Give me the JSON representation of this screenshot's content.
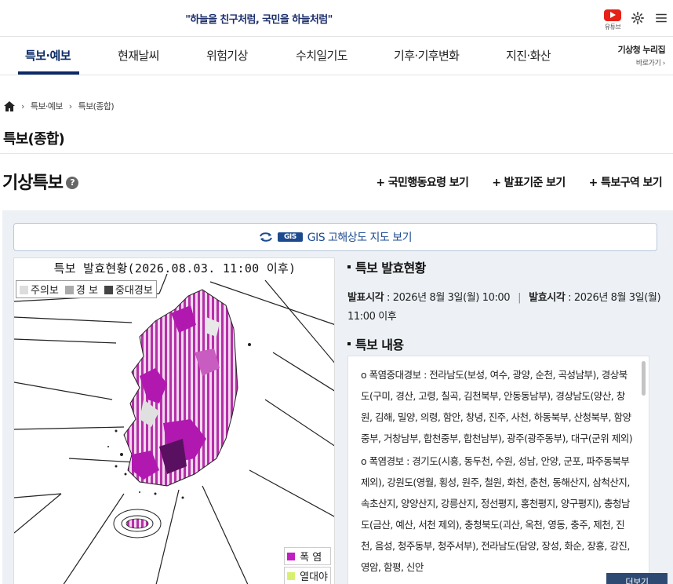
{
  "header": {
    "slogan": "\"하늘을 친구처럼, 국민을 하늘처럼\"",
    "youtube_label": "유튜브",
    "icons": [
      "youtube-icon",
      "gear-icon",
      "menu-icon"
    ]
  },
  "gnb": {
    "items": [
      "특보·예보",
      "현재날씨",
      "위험기상",
      "수치일기도",
      "기후·기후변화",
      "지진·화산"
    ],
    "active": "특보·예보",
    "right_title": "기상청 누리집",
    "right_link": "바로가기 ›"
  },
  "breadcrumb": {
    "home_icon": "home-icon",
    "items": [
      "특보·예보",
      "특보(종합)"
    ]
  },
  "page_title": "특보(종합)",
  "section": {
    "title": "기상특보",
    "help": "?",
    "links": [
      "+ 국민행동요령 보기",
      "+ 발표기준 보기",
      "+ 특보구역 보기"
    ]
  },
  "gis": {
    "badge": "GIS",
    "label": "GIS 고해상도 지도 보기"
  },
  "map": {
    "title": "특보 발효현황(2026.08.03. 11:00 이후)",
    "legend": [
      "주의보",
      "경 보",
      "중대경보"
    ],
    "hazards": [
      {
        "label": "폭 염",
        "color": "#c020c0"
      },
      {
        "label": "열대야",
        "color": "#d8f070"
      }
    ]
  },
  "info": {
    "status_heading": "특보 발효현황",
    "announce_label": "발표시각",
    "announce_value": " : 2026년 8월 3일(월) 10:00",
    "effective_label": "발효시각",
    "effective_value": " : 2026년 8월 3일(월) 11:00 이후",
    "content_heading": "특보 내용",
    "paragraphs": [
      "o 폭염중대경보 : 전라남도(보성, 여수, 광양, 순천, 곡성남부), 경상북도(구미, 경산, 고령, 칠곡, 김천북부, 안동동남부), 경상남도(양산, 창원, 김해, 밀양, 의령, 함안, 창녕, 진주, 사천, 하동북부, 산청북부, 함양중부, 거창남부, 합천중부, 합천남부), 광주(광주동부), 대구(군위 제외)",
      "o 폭염경보 : 경기도(시흥, 동두천, 수원, 성남, 안양, 군포, 파주동북부 제외), 강원도(영월, 횡성, 원주, 철원, 화천, 춘천, 동해산지, 삼척산지, 속초산지, 양양산지, 강릉산지, 정선평지, 홍천평지, 양구평지), 충청남도(금산, 예산, 서천 제외), 충청북도(괴산, 옥천, 영동, 충주, 제천, 진천, 음성, 청주동부, 청주서부), 전라남도(담양, 장성, 화순, 장흥, 강진, 영암, 함평, 신안"
    ],
    "more_label": "더보기"
  }
}
